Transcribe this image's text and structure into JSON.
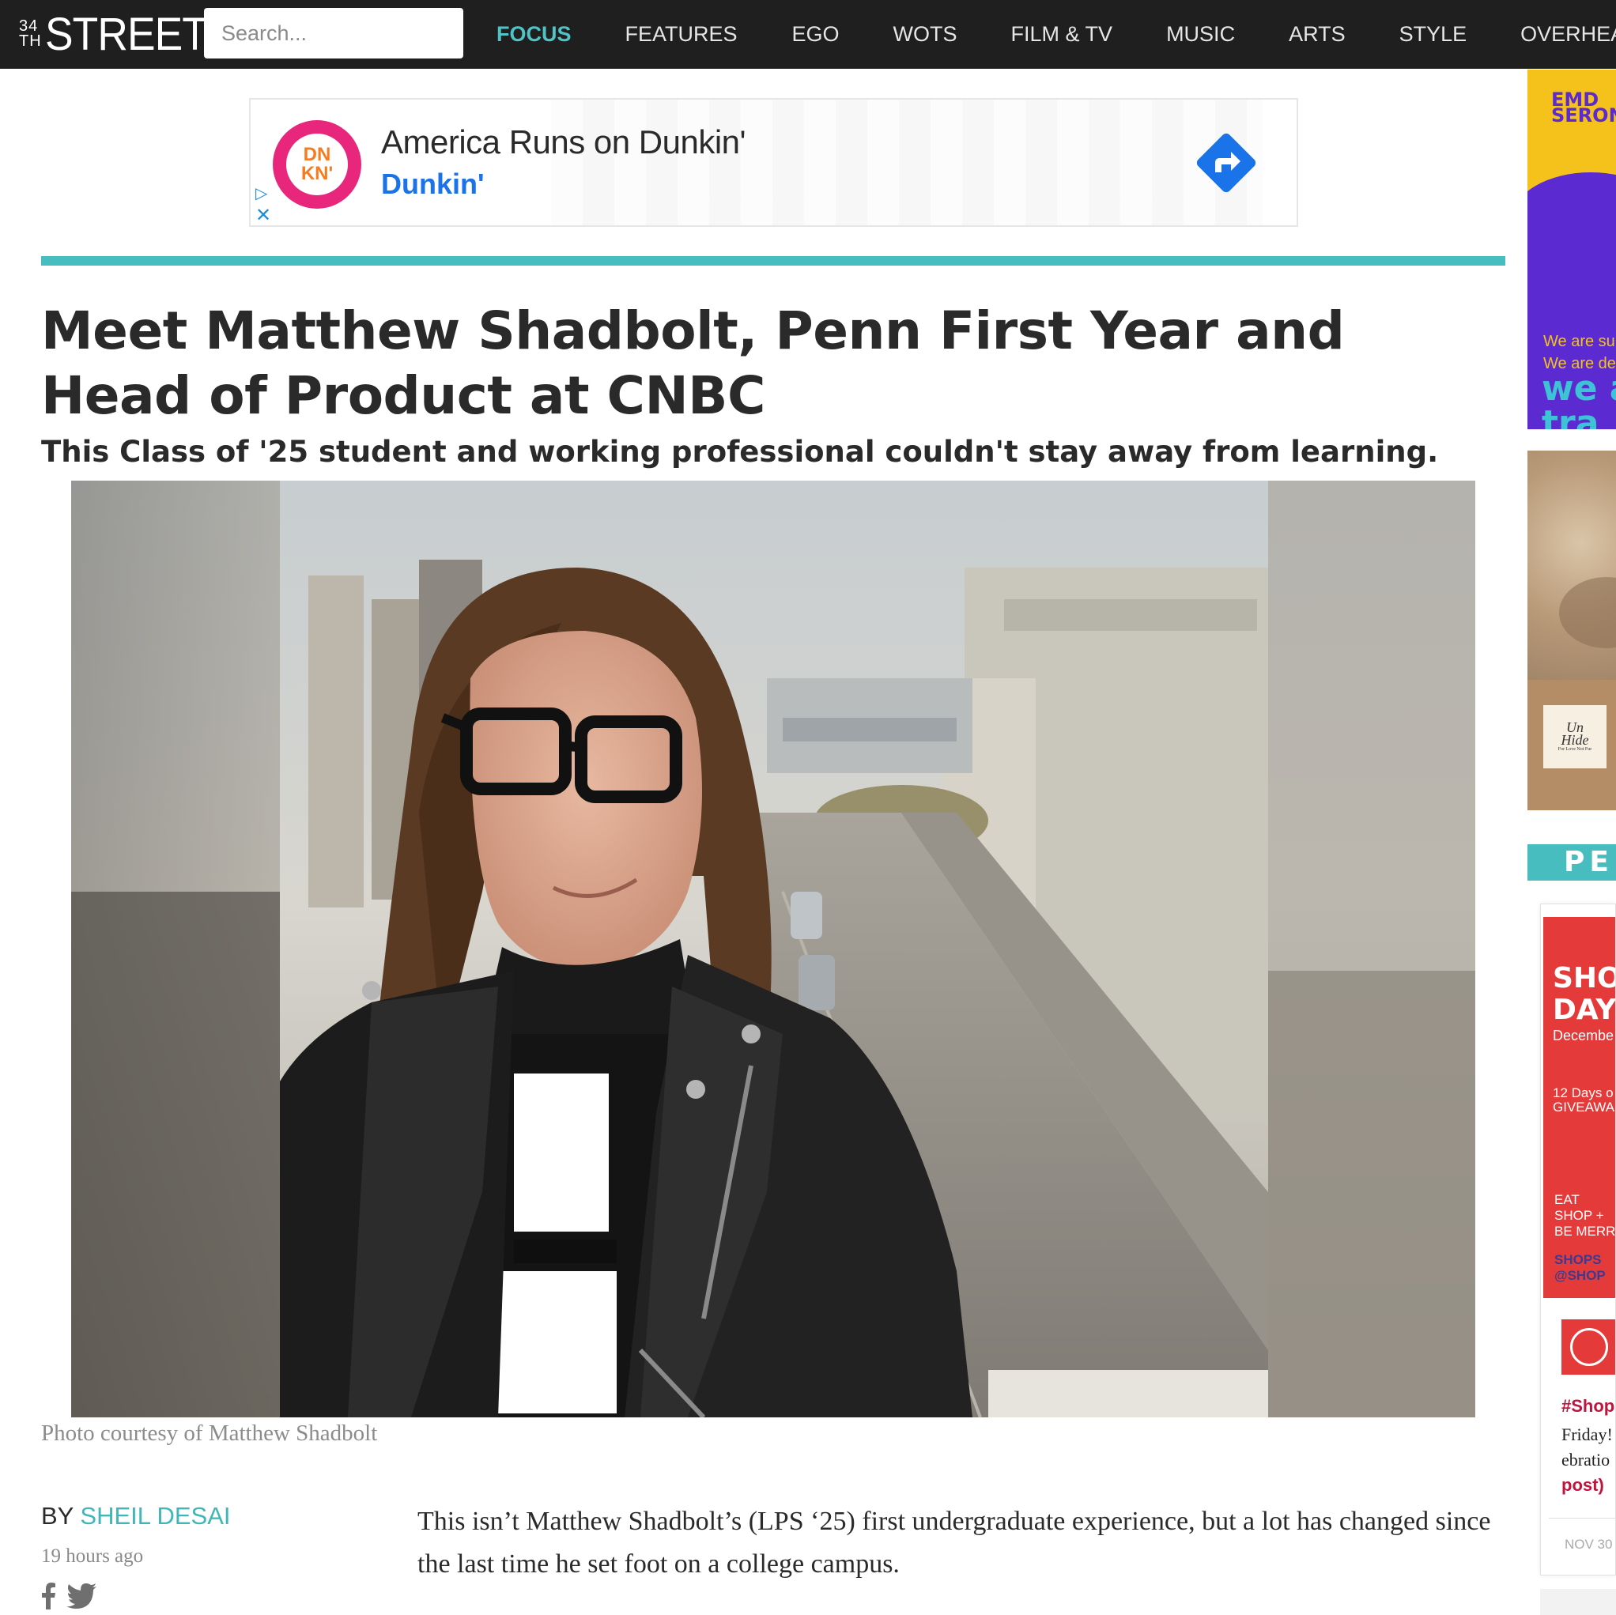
{
  "nav": {
    "logo_number_top": "34",
    "logo_number_bottom": "TH",
    "logo_word": "STREET",
    "search_placeholder": "Search...",
    "items": [
      {
        "label": "FOCUS",
        "active": true
      },
      {
        "label": "FEATURES",
        "active": false
      },
      {
        "label": "EGO",
        "active": false
      },
      {
        "label": "WOTS",
        "active": false
      },
      {
        "label": "FILM & TV",
        "active": false
      },
      {
        "label": "MUSIC",
        "active": false
      },
      {
        "label": "ARTS",
        "active": false
      },
      {
        "label": "STYLE",
        "active": false
      },
      {
        "label": "OVERHEARDS",
        "active": false
      }
    ],
    "background": "#1f1f1f",
    "active_color": "#4fc3c6"
  },
  "ad": {
    "logo_line1": "DN",
    "logo_line2": "KN'",
    "title": "America Runs on Dunkin'",
    "brand": "Dunkin'",
    "icons": [
      "adchoices-icon",
      "close-icon",
      "directions-arrow-icon"
    ]
  },
  "article": {
    "accent": "#47bdbf",
    "headline": "Meet Matthew Shadbolt, Penn First Year and Head of Product at CNBC",
    "subhead": "This Class of '25 student and working professional couldn't stay away from learning.",
    "photo_caption": "Photo courtesy of Matthew Shadbolt",
    "byline_prefix": "BY ",
    "author": "SHEIL DESAI",
    "timestamp": "19 hours ago",
    "share_icons": [
      "facebook-icon",
      "twitter-icon"
    ],
    "body_paragraph": "This isn’t Matthew Shadbolt’s (LPS ‘25) first undergraduate experience, but a lot has changed since the last time he set foot on a college campus."
  },
  "rail": {
    "ad1": {
      "brand_line1": "EMD",
      "brand_line2": "SERON",
      "text_line1": "We are su",
      "text_line2": "We are de",
      "big_line1": "we a",
      "big_line2": "tra"
    },
    "ad2": {
      "card_line1": "Un",
      "card_line2": "Hide",
      "card_line3": "For Love Not Fur"
    },
    "section_label": "PE",
    "post": {
      "headline_line1": "SHO",
      "headline_line2": "DAYS",
      "date_line": "Decembe",
      "giveaway_line1": "12 Days o",
      "giveaway_line2": "GIVEAWA",
      "cta_line1": "EAT",
      "cta_line2": "SHOP +",
      "cta_line3": "BE MERR",
      "handle_line1": "SHOPS",
      "handle_line2": "@SHOP",
      "hashtag": "#Shop",
      "text_line1": "Friday!",
      "text_line2": "ebratio",
      "text_line3": "post)",
      "date": "NOV 30"
    }
  }
}
